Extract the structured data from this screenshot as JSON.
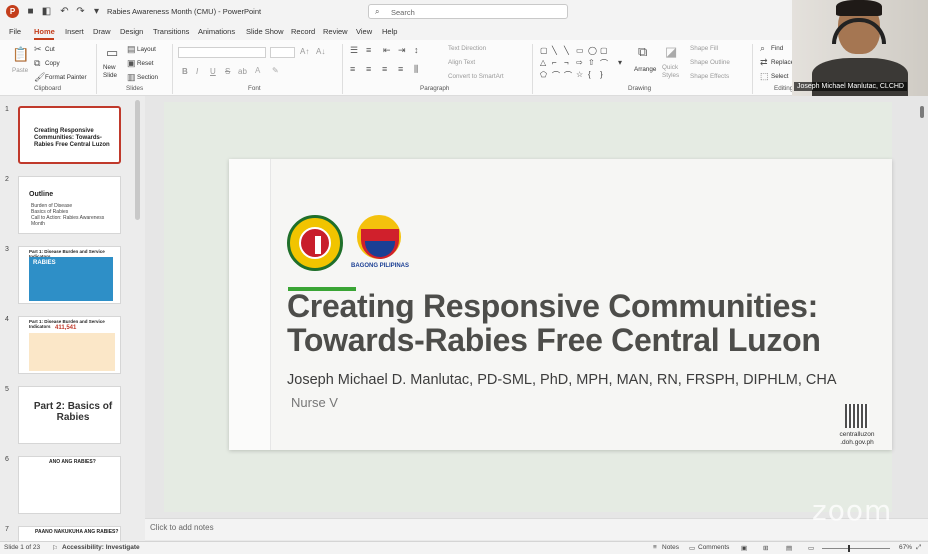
{
  "app": {
    "doc_title": "Rabies Awareness Month (CMU) - PowerPoint",
    "search_placeholder": "Search"
  },
  "menu": [
    "File",
    "Home",
    "Insert",
    "Draw",
    "Design",
    "Transitions",
    "Animations",
    "Slide Show",
    "Record",
    "Review",
    "View",
    "Help"
  ],
  "ribbon": {
    "clipboard": {
      "paste": "Paste",
      "cut": "Cut",
      "copy": "Copy",
      "format_painter": "Format Painter",
      "label": "Clipboard"
    },
    "slides": {
      "new_slide": "New Slide",
      "layout": "Layout",
      "reset": "Reset",
      "section": "Section",
      "label": "Slides"
    },
    "font": {
      "bold": "B",
      "italic": "I",
      "underline": "U",
      "strike": "S",
      "shadow": "ab",
      "label": "Font"
    },
    "paragraph": {
      "text_direction": "Text Direction",
      "align_text": "Align Text",
      "smartart": "Convert to SmartArt",
      "label": "Paragraph"
    },
    "drawing": {
      "arrange": "Arrange",
      "quick_styles": "Quick Styles",
      "shape_fill": "Shape Fill",
      "shape_outline": "Shape Outline",
      "shape_effects": "Shape Effects",
      "label": "Drawing"
    },
    "editing": {
      "find": "Find",
      "replace": "Replace",
      "select": "Select",
      "label": "Editing"
    }
  },
  "webcam": {
    "name": "Joseph Michael Manlutac, CLCHD"
  },
  "thumbnails": [
    {
      "num": "1",
      "title": "Creating Responsive Communities: Towards-Rabies Free Central Luzon"
    },
    {
      "num": "2",
      "title": "Outline",
      "lines": [
        "Burden of Disease",
        "Basics of Rabies",
        "Call to Action: Rabies Awareness Month"
      ]
    },
    {
      "num": "3",
      "title": "Part 1: Disease Burden and Service Indicators",
      "sub": "RABIES"
    },
    {
      "num": "4",
      "title": "Part 1: Disease Burden and Service Indicators",
      "big": "411,541"
    },
    {
      "num": "5",
      "title": "Part 2: Basics of Rabies"
    },
    {
      "num": "6",
      "title": "ANO ANG RABIES?"
    },
    {
      "num": "7",
      "title": "PAANO NAKUKUHA ANG RABIES?"
    }
  ],
  "slide": {
    "brand_label": "BAGONG PILIPINAS",
    "title_line1": "Creating Responsive Communities:",
    "title_line2": "Towards-Rabies Free Central Luzon",
    "author": "Joseph Michael D. Manlutac, PD-SML, PhD, MPH, MAN, RN, FRSPH, DIPHLM, CHA",
    "role": "Nurse V",
    "qr_text_1": "centralluzon",
    "qr_text_2": ".doh.gov.ph"
  },
  "notes_placeholder": "Click to add notes",
  "watermark": "zoom",
  "status": {
    "slide_of": "Slide 1 of 23",
    "accessibility": "Accessibility: Investigate",
    "notes": "Notes",
    "comments": "Comments",
    "zoom": "67%"
  },
  "colors": {
    "accent": "#c43e1c",
    "title_text": "#4d4d4a",
    "green_bar": "#3aa535"
  }
}
